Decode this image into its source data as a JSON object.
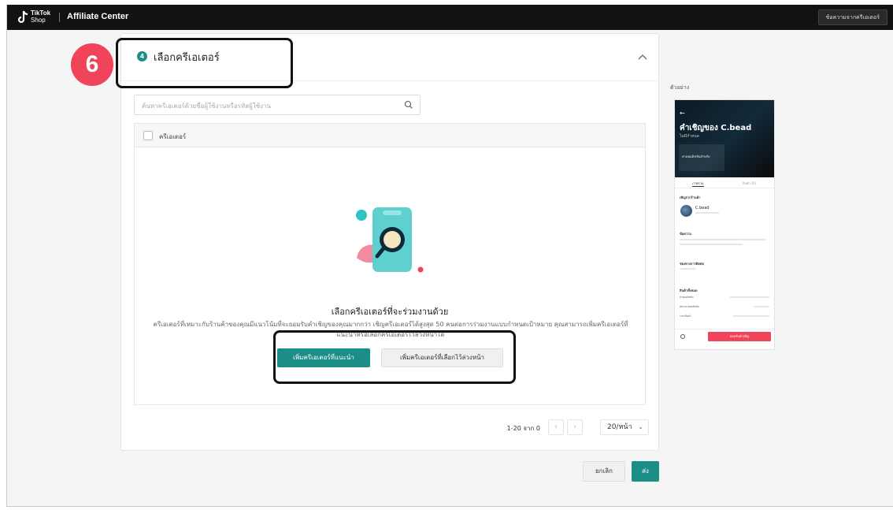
{
  "topbar": {
    "brand_line1": "TikTok",
    "brand_line2": "Shop",
    "app_name": "Affiliate Center",
    "right_button": "ข้อความจากครีเอเตอร์"
  },
  "annotation": {
    "step_badge": "6"
  },
  "section": {
    "step_number": "4",
    "title": "เลือกครีเอเตอร์"
  },
  "search": {
    "placeholder": "ค้นหาครีเอเตอร์ด้วยชื่อผู้ใช้งานหรือรหัสผู้ใช้งาน"
  },
  "table": {
    "column_header": "ครีเอเตอร์"
  },
  "empty_state": {
    "title": "เลือกครีเอเตอร์ที่จะร่วมงานด้วย",
    "description": "ครีเอเตอร์ที่เหมาะกับร้านค้าของคุณมีแนวโน้มที่จะยอมรับคำเชิญของคุณมากกว่า เชิญครีเอเตอร์ได้สูงสุด 50 คนต่อการร่วมงานแบบกำหนดเป้าหมาย คุณสามารถเพิ่มครีเอเตอร์ที่แนะนำหรือเลือกครีเอเตอร์ไว้ล่วงหน้าได้",
    "primary_button": "เพิ่มครีเอเตอร์ที่แนะนำ",
    "secondary_button": "เพิ่มครีเอเตอร์ที่เลือกไว้ล่วงหน้า"
  },
  "pagination": {
    "range": "1-20 จาก 0",
    "prev": "‹",
    "next": "›",
    "page_size": "20/หน้า"
  },
  "footer": {
    "cancel": "ยกเลิก",
    "send": "ส่ง"
  },
  "preview": {
    "label": "ตัวอย่าง",
    "back": "←",
    "title": "คำเชิญของ C.bead",
    "subtitle": "ไม่มีกำหนด",
    "hero_text": "ค่าคอมมิชชันสำหรับ",
    "tab1": "ภาพรวม",
    "tab2": "สินค้า (0)",
    "sender_label": "เชิญจากร้านค้า",
    "sender_name": "C.bead",
    "message_label": "ข้อความ",
    "contact_label": "ช่องทางการติดต่อ",
    "product_label": "สินค้าทั้งหมด",
    "row1": "ค่าคอมมิชชัน",
    "row2": "อัตราค่าคอมมิชชัน",
    "row3": "ราคาสินค้า",
    "accept_button": "ยอมรับคำเชิญ",
    "accent_color": "#f0445a"
  },
  "colors": {
    "primary": "#1b8f87",
    "annotation": "#f0445a",
    "topbar": "#121212"
  }
}
